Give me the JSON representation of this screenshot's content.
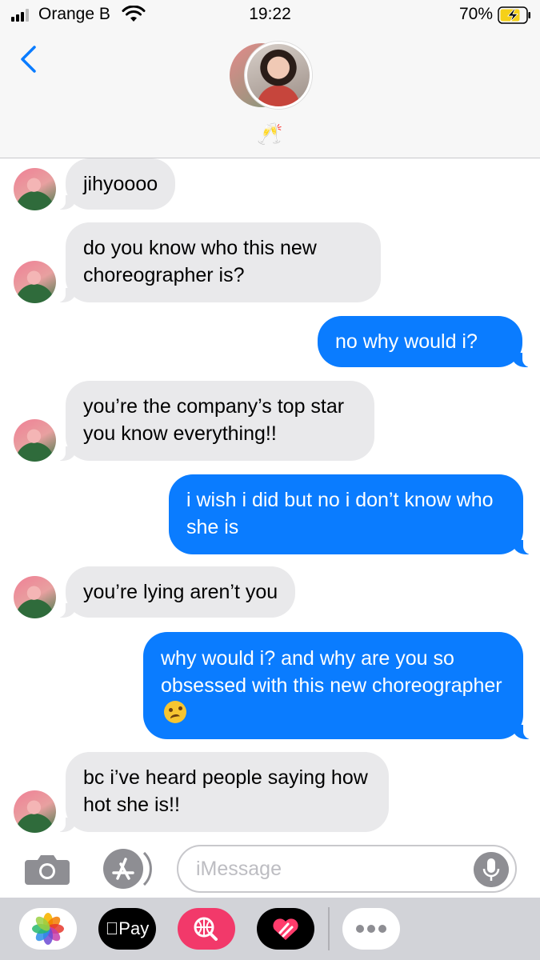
{
  "status_bar": {
    "carrier": "Orange B",
    "time": "19:22",
    "battery": "70%"
  },
  "header": {
    "contact_name_emoji": "🥂"
  },
  "messages": [
    {
      "direction": "incoming",
      "text": "jihyoooo"
    },
    {
      "direction": "incoming",
      "text": "do you know who this new choreographer is?"
    },
    {
      "direction": "outgoing",
      "text": "no why would i?"
    },
    {
      "direction": "incoming",
      "text": "you’re the company’s top star you know everything!!"
    },
    {
      "direction": "outgoing",
      "text": "i wish i did but no i don’t know who she is"
    },
    {
      "direction": "incoming",
      "text": "you’re lying aren’t you"
    },
    {
      "direction": "outgoing",
      "text": "why would i? and why are you so obsessed with this new choreographer",
      "emoji": "woozy-face-icon"
    },
    {
      "direction": "incoming",
      "text": "bc i’ve heard people saying how hot she is!!"
    }
  ],
  "composer": {
    "placeholder": "iMessage",
    "value": ""
  },
  "app_drawer": {
    "apple_pay_label": "Pay"
  },
  "colors": {
    "outgoing_bubble": "#0a7cff",
    "incoming_bubble": "#e9e9eb",
    "back_chevron": "#0a7cff"
  }
}
